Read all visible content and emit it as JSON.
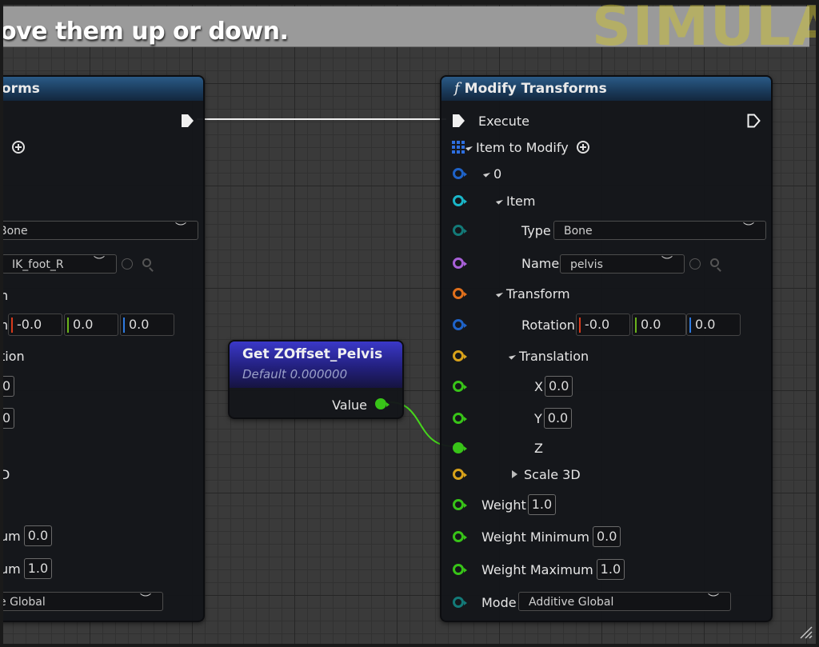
{
  "comment": {
    "text": "ove them up or down.",
    "watermark": "SIMULA"
  },
  "left_node": {
    "title_fragment": "orms",
    "type_value": "Bone",
    "name_value": "IK_foot_R",
    "transform_label": "n",
    "rotation_label_fragment": "n",
    "rotation": [
      "-0.0",
      "0.0",
      "0.0"
    ],
    "translation_label": "tion",
    "x_value": "0",
    "y_value": "0",
    "scale_label": "D",
    "weight_min_label": "um",
    "weight_min_value": "0.0",
    "weight_max_label": "um",
    "weight_max_value": "1.0",
    "mode_value": "e Global"
  },
  "get_node": {
    "title": "Get ZOffset_Pelvis",
    "subtitle": "Default 0.000000",
    "output_label": "Value"
  },
  "modify_node": {
    "title": "Modify Transforms",
    "execute_label": "Execute",
    "item_to_modify_label": "Item to Modify",
    "index_label": "0",
    "item_label": "Item",
    "type_label": "Type",
    "type_value": "Bone",
    "name_label": "Name",
    "name_value": "pelvis",
    "transform_label": "Transform",
    "rotation_label": "Rotation",
    "rotation": [
      "-0.0",
      "0.0",
      "0.0"
    ],
    "translation_label": "Translation",
    "x_label": "X",
    "x_value": "0.0",
    "y_label": "Y",
    "y_value": "0.0",
    "z_label": "Z",
    "scale_label": "Scale 3D",
    "weight_label": "Weight",
    "weight_value": "1.0",
    "weight_min_label": "Weight Minimum",
    "weight_min_value": "0.0",
    "weight_max_label": "Weight Maximum",
    "weight_max_value": "1.0",
    "mode_label": "Mode",
    "mode_value": "Additive Global"
  },
  "colors": {
    "pin_struct_blue": "#1f63c8",
    "pin_cyan": "#1ab6c8",
    "pin_teal": "#137a78",
    "pin_purple": "#a860d8",
    "pin_orange": "#e0701c",
    "pin_gold": "#d8a21a",
    "pin_green": "#38c418",
    "wire_green": "#46d61c"
  }
}
